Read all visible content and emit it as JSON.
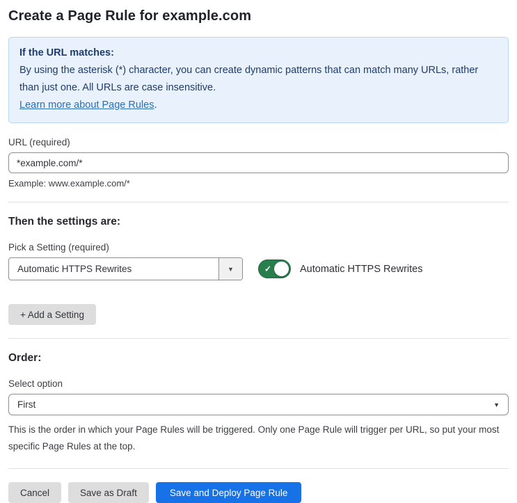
{
  "page": {
    "title": "Create a Page Rule for example.com"
  },
  "info_box": {
    "heading": "If the URL matches:",
    "body": "By using the asterisk (*) character, you can create dynamic patterns that can match many URLs, rather than just one. All URLs are case insensitive.",
    "link_label": "Learn more about Page Rules",
    "link_suffix": "."
  },
  "url_field": {
    "label": "URL (required)",
    "value": "*example.com/*",
    "example": "Example: www.example.com/*"
  },
  "settings_section": {
    "heading": "Then the settings are:",
    "picker_label": "Pick a Setting (required)",
    "picker_value": "Automatic HTTPS Rewrites",
    "toggle_label": "Automatic HTTPS Rewrites",
    "toggle_state": "on",
    "add_button_label": "+ Add a Setting"
  },
  "order_section": {
    "heading": "Order:",
    "select_label": "Select option",
    "select_value": "First",
    "help_text": "This is the order in which your Page Rules will be triggered. Only one Page Rule will trigger per URL, so put your most specific Page Rules at the top."
  },
  "footer": {
    "cancel_label": "Cancel",
    "save_draft_label": "Save as Draft",
    "save_deploy_label": "Save and Deploy Page Rule"
  },
  "icons": {
    "caret_down": "▼",
    "check": "✓"
  },
  "colors": {
    "accent_blue": "#1672e6",
    "info_bg": "#e9f2fc",
    "info_border": "#b9d7f1",
    "info_text": "#1e3c6e",
    "link_blue": "#2c6cb5",
    "toggle_green": "#297e4d",
    "button_gray": "#dddddd"
  }
}
